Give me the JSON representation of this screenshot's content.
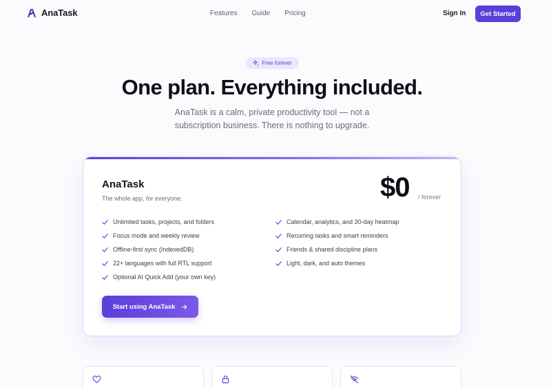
{
  "nav": {
    "brand": "AnaTask",
    "links": [
      "Features",
      "Guide",
      "Pricing"
    ],
    "sign_in": "Sign In",
    "get_started": "Get Started"
  },
  "hero": {
    "badge": "Free forever",
    "title": "One plan. Everything included.",
    "subtitle": "AnaTask is a calm, private productivity tool — not a subscription business. There is nothing to upgrade."
  },
  "plan": {
    "name": "AnaTask",
    "description": "The whole app, for everyone.",
    "price": "$0",
    "period": "/ forever",
    "features_left": [
      "Unlimited tasks, projects, and folders",
      "Focus mode and weekly review",
      "Offline-first sync (IndexedDB)",
      "22+ languages with full RTL support",
      "Optional AI Quick Add (your own key)"
    ],
    "features_right": [
      "Calendar, analytics, and 30-day heatmap",
      "Recurring tasks and smart reminders",
      "Friends & shared discipline plans",
      "Light, dark, and auto themes"
    ],
    "cta": "Start using AnaTask"
  },
  "bottom_cards": {
    "icons": [
      "heart-icon",
      "lock-icon",
      "wifi-off-icon"
    ]
  },
  "colors": {
    "accent": "#5b3fd8",
    "accent_light": "#ebe7fb",
    "check": "#5b3fd8"
  }
}
